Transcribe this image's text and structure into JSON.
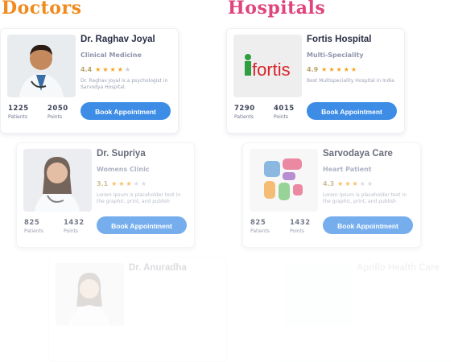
{
  "sections": {
    "doctors_title": "Doctors",
    "hospitals_title": "Hospitals"
  },
  "doctors": [
    {
      "name": "Dr. Raghav Joyal",
      "specialty": "Clinical Medicine",
      "rating": "4.4",
      "stars": 4,
      "description": "Dr. Raghav Joyal is a psychologist in Sarvodya Hospital.",
      "patients": "1225",
      "patients_label": "Patients",
      "points": "2050",
      "points_label": "Points",
      "button": "Book Appointment"
    },
    {
      "name": "Dr. Supriya",
      "specialty": "Womens Clinic",
      "rating": "3.1",
      "stars": 3,
      "description": "Lorem Ipsum is placeholder text in the graphic, print, and publish",
      "patients": "825",
      "patients_label": "Patients",
      "points": "1432",
      "points_label": "Points",
      "button": "Book Appointment"
    },
    {
      "name": "Dr. Anuradha",
      "specialty": "",
      "rating": "",
      "stars": 0,
      "description": "",
      "patients": "",
      "patients_label": "",
      "points": "",
      "points_label": "",
      "button": ""
    }
  ],
  "hospitals": [
    {
      "name": "Fortis Hospital",
      "specialty": "Multi-Speciality",
      "rating": "4.9",
      "stars": 5,
      "logo_text": "fortis",
      "description": "Best Multispeciality Hospital in India",
      "patients": "7290",
      "patients_label": "Patients",
      "points": "4015",
      "points_label": "Points",
      "button": "Book Appointment"
    },
    {
      "name": "Sarvodaya Care",
      "specialty": "Heart Patient",
      "rating": "4.3",
      "stars": 3,
      "description": "Lorem Ipsum is placeholder text in the graphic, print, and publish",
      "patients": "825",
      "patients_label": "Patients",
      "points": "1432",
      "points_label": "Points",
      "button": "Book Appointment"
    },
    {
      "name": "Apollo Health Care",
      "specialty": "",
      "rating": "",
      "stars": 0,
      "description": "",
      "patients": "",
      "patients_label": "",
      "points": "",
      "points_label": "",
      "button": ""
    }
  ],
  "colors": {
    "doctors_title": "#f08a1c",
    "hospitals_title": "#e0447d",
    "button": "#3d8ce6",
    "star_on": "#f4a322",
    "fortis_green": "#2e9e3e",
    "fortis_red": "#d7242a"
  }
}
